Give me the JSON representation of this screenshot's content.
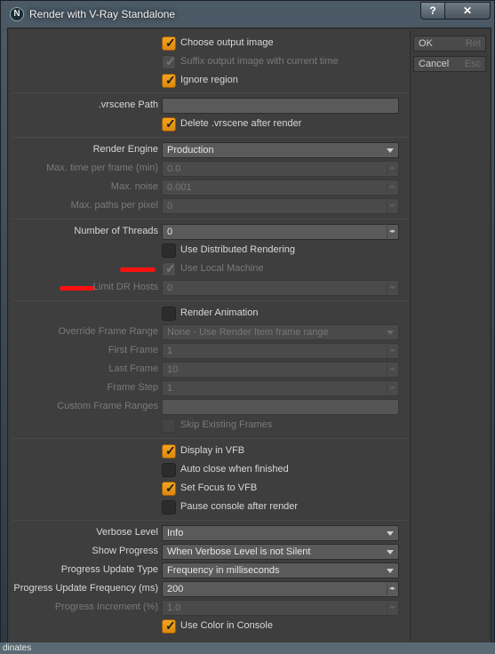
{
  "window": {
    "title": "Render with V-Ray Standalone",
    "icon_letter": "N",
    "help_button": "?",
    "close_button": "✕"
  },
  "side_buttons": {
    "ok": {
      "label": "OK",
      "key": "Ret"
    },
    "cancel": {
      "label": "Cancel",
      "key": "Esc"
    }
  },
  "output": {
    "choose_output_image": "Choose output image",
    "suffix_output_image": "Suffix output image with current time",
    "ignore_region": "Ignore region"
  },
  "vrscene": {
    "path_label": ".vrscene Path",
    "path_value": "",
    "delete_after_render": "Delete .vrscene after render"
  },
  "engine": {
    "render_engine_label": "Render Engine",
    "render_engine_value": "Production",
    "max_time_label": "Max. time per frame (min)",
    "max_time_value": "0.0",
    "max_noise_label": "Max. noise",
    "max_noise_value": "0.001",
    "max_paths_label": "Max. paths per pixel",
    "max_paths_value": "0"
  },
  "threads": {
    "num_threads_label": "Number of Threads",
    "num_threads_value": "0",
    "use_distributed": "Use Distributed Rendering",
    "use_local_machine": "Use Local Machine",
    "limit_dr_hosts_label": "Limit DR Hosts",
    "limit_dr_hosts_value": "0"
  },
  "animation": {
    "render_animation": "Render Animation",
    "override_range_label": "Override Frame Range",
    "override_range_value": "None - Use Render Item frame range",
    "first_frame_label": "First Frame",
    "first_frame_value": "1",
    "last_frame_label": "Last Frame",
    "last_frame_value": "10",
    "frame_step_label": "Frame Step",
    "frame_step_value": "1",
    "custom_ranges_label": "Custom Frame Ranges",
    "custom_ranges_value": "",
    "skip_existing": "Skip Existing Frames"
  },
  "vfb": {
    "display_in_vfb": "Display in VFB",
    "auto_close": "Auto close when finished",
    "set_focus": "Set Focus to VFB",
    "pause_console": "Pause console after render"
  },
  "console": {
    "verbose_label": "Verbose Level",
    "verbose_value": "Info",
    "show_progress_label": "Show Progress",
    "show_progress_value": "When Verbose Level is not Silent",
    "progress_type_label": "Progress Update Type",
    "progress_type_value": "Frequency in milliseconds",
    "progress_freq_label": "Progress Update Frequency (ms)",
    "progress_freq_value": "200",
    "progress_incr_label": "Progress Increment (%)",
    "progress_incr_value": "1.0",
    "use_color": "Use Color in Console"
  },
  "background_text": "dinates",
  "spin_glyph": "◂▸",
  "check_glyph": "✓",
  "colors": {
    "accent_checkbox": "#f4a320",
    "annotation_red": "#ff1010"
  }
}
